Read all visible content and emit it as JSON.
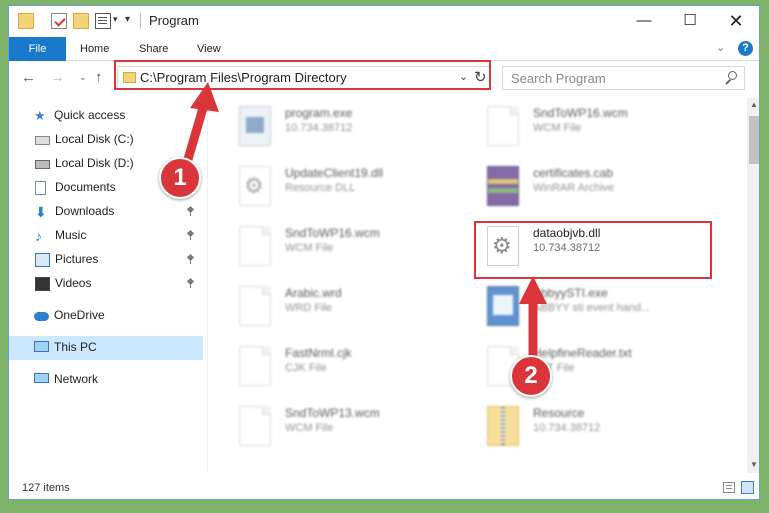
{
  "window": {
    "title": "Program",
    "controls": {
      "minimize": "—",
      "maximize": "☐",
      "close": "✕"
    }
  },
  "quick_access_toolbar": {
    "dropdown_glyph": "▾",
    "customize_glyph": "▾"
  },
  "ribbon": {
    "tabs": [
      "File",
      "Home",
      "Share",
      "View"
    ],
    "collapse_glyph": "⌄",
    "help_glyph": "?"
  },
  "navigation": {
    "back_glyph": "←",
    "forward_glyph": "→",
    "recent_glyph": "⌄",
    "up_glyph": "↑",
    "address_path": "C:\\Program Files\\Program Directory",
    "address_dropdown_glyph": "⌄",
    "refresh_glyph": "↻",
    "search_placeholder": "Search Program"
  },
  "sidebar": {
    "items": [
      {
        "label": "Quick access",
        "icon": "star-icon"
      },
      {
        "label": "Local Disk (C:)",
        "icon": "drive-icon"
      },
      {
        "label": "Local Disk (D:)",
        "icon": "drive-icon"
      },
      {
        "label": "Documents",
        "icon": "documents-icon"
      },
      {
        "label": "Downloads",
        "icon": "download-icon",
        "pinned": true
      },
      {
        "label": "Music",
        "icon": "music-icon",
        "pinned": true
      },
      {
        "label": "Pictures",
        "icon": "pictures-icon",
        "pinned": true
      },
      {
        "label": "Videos",
        "icon": "videos-icon",
        "pinned": true
      },
      {
        "label": "OneDrive",
        "icon": "cloud-icon"
      },
      {
        "label": "This PC",
        "icon": "computer-icon",
        "selected": true
      },
      {
        "label": "Network",
        "icon": "network-icon"
      }
    ],
    "glyphs": {
      "star": "★",
      "download": "⬇",
      "music": "♪"
    }
  },
  "files": [
    {
      "name": "program.exe",
      "meta": "10.734.38712",
      "icon": "exe-icon"
    },
    {
      "name": "SndToWP16.wcm",
      "meta": "WCM File",
      "icon": "file-icon"
    },
    {
      "name": "UpdateClient19.dll",
      "meta": "Resource DLL",
      "icon": "dll-icon"
    },
    {
      "name": "certificates.cab",
      "meta": "WinRAR Archive",
      "icon": "archive-icon"
    },
    {
      "name": "SndToWP16.wcm",
      "meta": "WCM File",
      "icon": "file-icon"
    },
    {
      "name": "dataobjvb.dll",
      "meta": "10.734.38712",
      "icon": "dll-icon"
    },
    {
      "name": "Arabic.wrd",
      "meta": "WRD File",
      "icon": "file-icon"
    },
    {
      "name": "AbbyySTI.exe",
      "meta": "ABBYY sti event hand...",
      "icon": "app-icon"
    },
    {
      "name": "FastNrml.cjk",
      "meta": "CJK File",
      "icon": "file-icon"
    },
    {
      "name": "HelpfineReader.txt",
      "meta": "TXT File",
      "icon": "text-icon"
    },
    {
      "name": "SndToWP13.wcm",
      "meta": "WCM File",
      "icon": "file-icon"
    },
    {
      "name": "Resource",
      "meta": "10.734.38712",
      "icon": "zip-folder-icon"
    }
  ],
  "status": {
    "item_count": "127 items"
  },
  "scrollbar": {
    "up_glyph": "▲",
    "down_glyph": "▼"
  },
  "callouts": [
    "1",
    "2"
  ],
  "colors": {
    "accent": "#1979ca",
    "highlight": "#d9353b",
    "selection": "#cce8ff"
  }
}
